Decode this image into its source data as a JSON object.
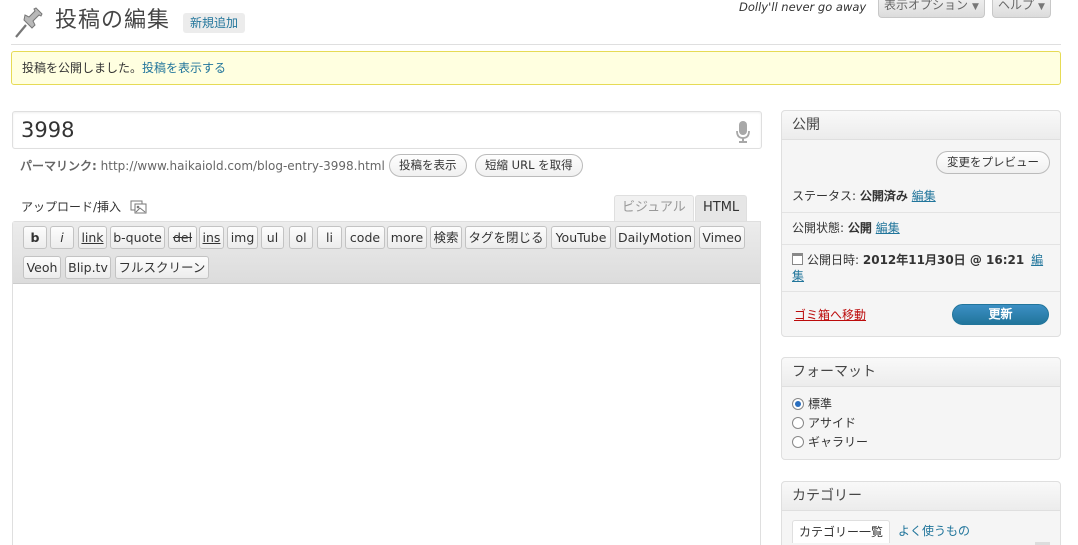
{
  "header": {
    "title": "投稿の編集",
    "add_new": "新規追加",
    "dolly": "Dolly'll never go away",
    "screen_options": "表示オプション",
    "help": "ヘルプ"
  },
  "notice": {
    "text": "投稿を公開しました。",
    "link": "投稿を表示する"
  },
  "post": {
    "title": "3998",
    "permalink_label": "パーマリンク:",
    "permalink_url": "http://www.haikaiold.com/blog-entry-3998.html",
    "view_post_button": "投稿を表示",
    "shortlink_button": "短縮 URL を取得"
  },
  "editor": {
    "upload_label": "アップロード/挿入",
    "tab_visual": "ビジュアル",
    "tab_html": "HTML",
    "quicktags": [
      "b",
      "i",
      "link",
      "b-quote",
      "del",
      "ins",
      "img",
      "ul",
      "ol",
      "li",
      "code",
      "more",
      "検索",
      "タグを閉じる",
      "YouTube",
      "DailyMotion",
      "Vimeo",
      "Veoh",
      "Blip.tv",
      "フルスクリーン"
    ]
  },
  "publish_box": {
    "title": "公開",
    "preview_button": "変更をプレビュー",
    "status_label": "ステータス:",
    "status_value": "公開済み",
    "visibility_label": "公開状態:",
    "visibility_value": "公開",
    "date_label": "公開日時:",
    "date_value": "2012年11月30日 @ 16:21",
    "edit_link": "編集",
    "edit_link_wrap_1": "編",
    "edit_link_wrap_2": "集",
    "trash_link": "ゴミ箱へ移動",
    "update_button": "更新"
  },
  "format_box": {
    "title": "フォーマット",
    "options": [
      "標準",
      "アサイド",
      "ギャラリー"
    ],
    "selected": "標準"
  },
  "category_box": {
    "title": "カテゴリー",
    "tab_all": "カテゴリー一覧",
    "tab_popular": "よく使うもの"
  }
}
